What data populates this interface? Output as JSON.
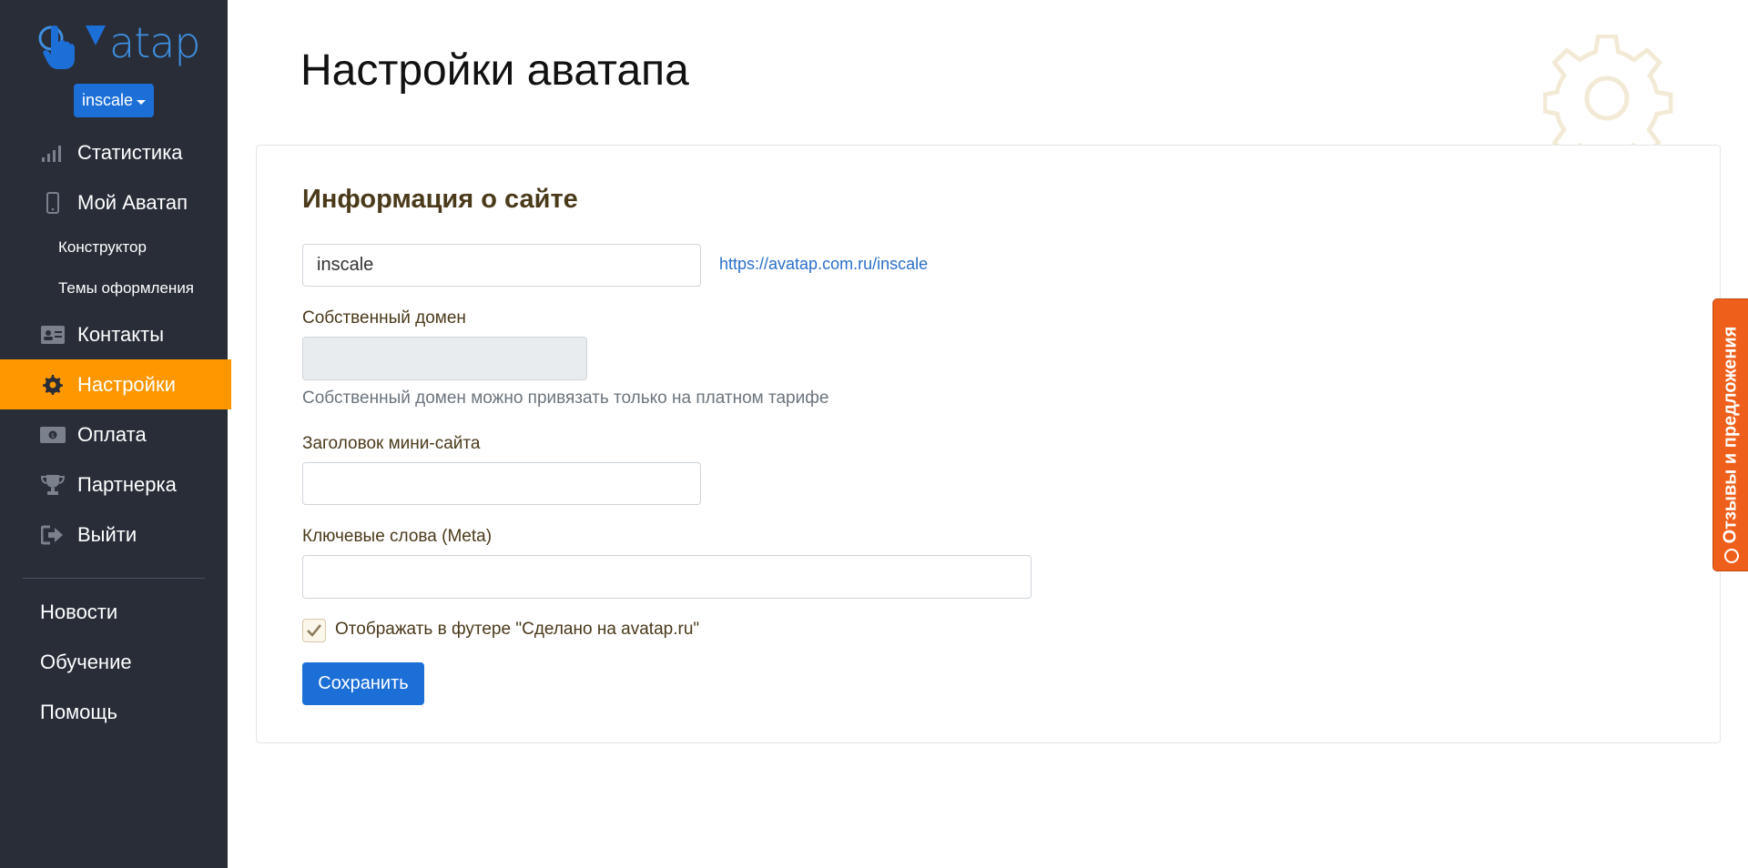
{
  "app": {
    "logo_text": "atap",
    "site_switch": "inscale"
  },
  "sidebar": {
    "items": [
      {
        "label": "Статистика",
        "icon": "bar-chart-icon"
      },
      {
        "label": "Мой Аватап",
        "icon": "mobile-icon"
      },
      {
        "label": "Конструктор"
      },
      {
        "label": "Темы оформления"
      },
      {
        "label": "Контакты",
        "icon": "contact-card-icon"
      },
      {
        "label": "Настройки",
        "icon": "gear-icon",
        "active": true
      },
      {
        "label": "Оплата",
        "icon": "money-icon"
      },
      {
        "label": "Партнерка",
        "icon": "trophy-icon"
      },
      {
        "label": "Выйти",
        "icon": "sign-out-icon"
      }
    ],
    "secondary": [
      "Новости",
      "Обучение",
      "Помощь"
    ]
  },
  "page": {
    "title": "Настройки аватапа"
  },
  "form": {
    "section_title": "Информация о сайте",
    "site_name_value": "inscale",
    "site_link": "https://avatap.com.ru/inscale",
    "own_domain_label": "Собственный домен",
    "own_domain_value": "",
    "own_domain_help": "Собственный домен можно привязать только на платном тарифе",
    "title_label": "Заголовок мини-сайта",
    "title_value": "",
    "keywords_label": "Ключевые слова (Meta)",
    "keywords_value": "",
    "footer_checkbox_label": "Отображать в футере \"Сделано на avatap.ru\"",
    "footer_checkbox_checked": true,
    "save_label": "Сохранить"
  },
  "feedback": {
    "label": "Отзывы и предложения"
  },
  "colors": {
    "sidebar_bg": "#282d38",
    "active_item": "#ff9800",
    "primary_button": "#1d6fd8",
    "feedback_tab": "#ee5f1b"
  }
}
